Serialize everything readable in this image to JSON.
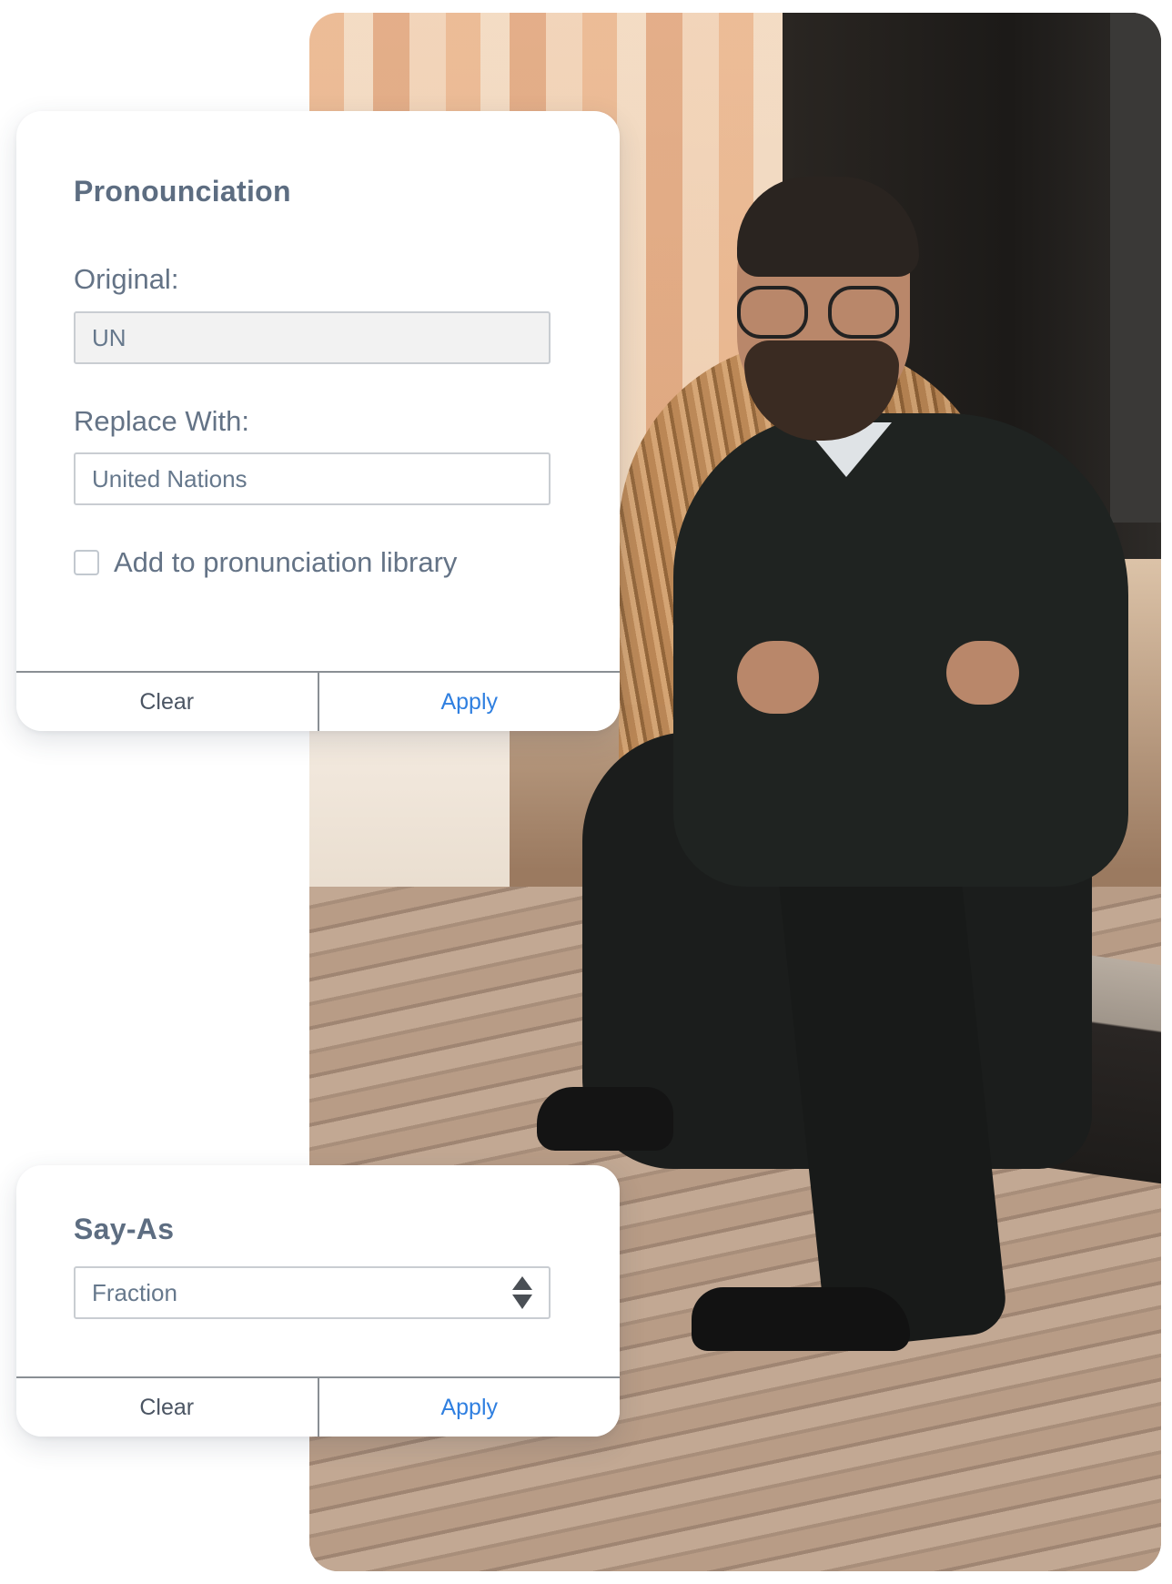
{
  "pronunciation": {
    "title": "Pronounciation",
    "original_label": "Original:",
    "original_value": "UN",
    "replace_label": "Replace With:",
    "replace_value": "United Nations",
    "library_checkbox_label": "Add to pronunciation library",
    "library_checked": false,
    "clear_label": "Clear",
    "apply_label": "Apply"
  },
  "say_as": {
    "title": "Say-As",
    "selected": "Fraction",
    "clear_label": "Clear",
    "apply_label": "Apply"
  },
  "colors": {
    "title": "#5d6d81",
    "label": "#647386",
    "apply_accent": "#2f7fe0",
    "clear": "#4b5563",
    "input_readonly_bg": "#f2f2f2"
  },
  "icons": {
    "select_arrows": "up-down-arrows-icon",
    "checkbox": "checkbox-icon"
  }
}
